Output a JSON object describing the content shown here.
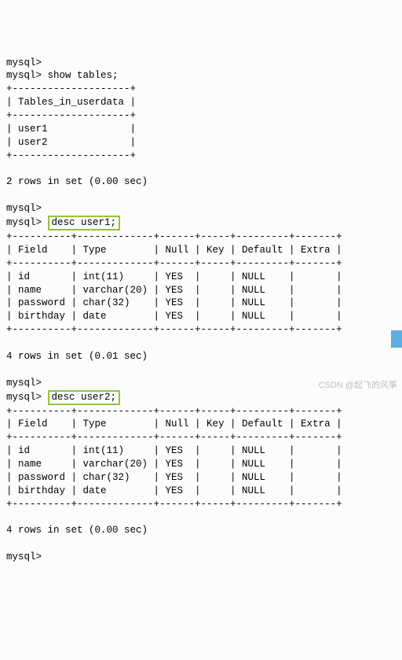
{
  "prompts": {
    "p1": "mysql>",
    "p2": "mysql> show tables;",
    "p3": "mysql>",
    "p4": "mysql>",
    "p5": "desc user1;",
    "p6": "mysql>",
    "p7": "mysql>",
    "p8": "desc user2;",
    "p9": "mysql>"
  },
  "tables_list": {
    "border_top": "+--------------------+",
    "header": "| Tables_in_userdata |",
    "row1": "| user1              |",
    "row2": "| user2              |",
    "summary": "2 rows in set (0.00 sec)"
  },
  "desc1": {
    "border": "+----------+-------------+------+-----+---------+-------+",
    "header": "| Field    | Type        | Null | Key | Default | Extra |",
    "r1": "| id       | int(11)     | YES  |     | NULL    |       |",
    "r2": "| name     | varchar(20) | YES  |     | NULL    |       |",
    "r3": "| password | char(32)    | YES  |     | NULL    |       |",
    "r4": "| birthday | date        | YES  |     | NULL    |       |",
    "summary": "4 rows in set (0.01 sec)"
  },
  "desc2": {
    "border": "+----------+-------------+------+-----+---------+-------+",
    "header": "| Field    | Type        | Null | Key | Default | Extra |",
    "r1": "| id       | int(11)     | YES  |     | NULL    |       |",
    "r2": "| name     | varchar(20) | YES  |     | NULL    |       |",
    "r3": "| password | char(32)    | YES  |     | NULL    |       |",
    "r4": "| birthday | date        | YES  |     | NULL    |       |",
    "summary": "4 rows in set (0.00 sec)"
  },
  "watermark": "CSDN @起飞的风筝"
}
